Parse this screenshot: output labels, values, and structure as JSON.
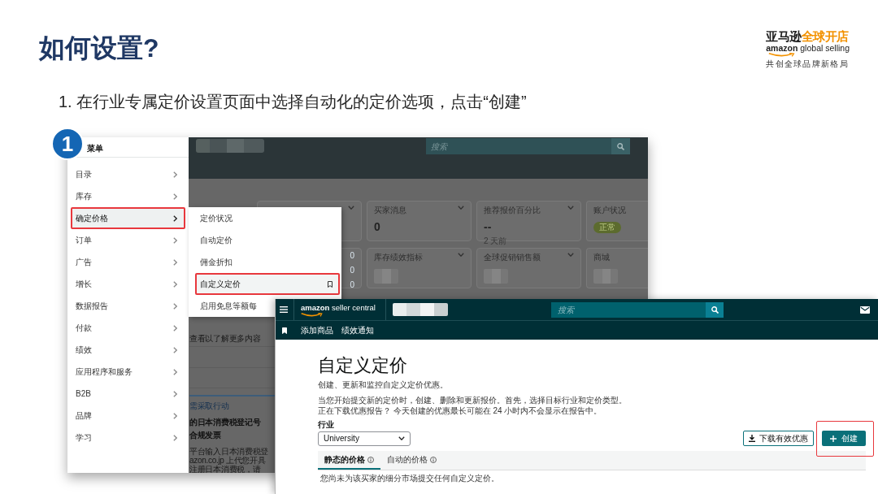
{
  "title": "如何设置?",
  "logo": {
    "wordmark": "亚马逊",
    "wordmark_accent": "全球开店",
    "brand_line": "**amazon** global selling",
    "slogan": "共创全球品牌新格局"
  },
  "instruction": "1. 在行业专属定价设置页面中选择自动化的定价选项，点击“创建”",
  "menu_screenshot": {
    "step_number": "1",
    "menu_title": "菜单",
    "menu_items": [
      {
        "label": "目录",
        "selected": false,
        "highlighted": false
      },
      {
        "label": "库存",
        "selected": false,
        "highlighted": false
      },
      {
        "label": "确定价格",
        "selected": true,
        "highlighted": true
      },
      {
        "label": "订单",
        "selected": false,
        "highlighted": false
      },
      {
        "label": "广告",
        "selected": false,
        "highlighted": false
      },
      {
        "label": "增长",
        "selected": false,
        "highlighted": false
      },
      {
        "label": "数据报告",
        "selected": false,
        "highlighted": false
      },
      {
        "label": "付款",
        "selected": false,
        "highlighted": false
      },
      {
        "label": "绩效",
        "selected": false,
        "highlighted": false
      },
      {
        "label": "应用程序和服务",
        "selected": false,
        "highlighted": false
      },
      {
        "label": "B2B",
        "selected": false,
        "highlighted": false
      },
      {
        "label": "品牌",
        "selected": false,
        "highlighted": false
      },
      {
        "label": "学习",
        "selected": false,
        "highlighted": false
      }
    ],
    "submenu_items": [
      {
        "label": "定价状况",
        "selected": false,
        "highlighted": false
      },
      {
        "label": "自动定价",
        "selected": false,
        "highlighted": false
      },
      {
        "label": "佣金折扣",
        "selected": false,
        "highlighted": false
      },
      {
        "label": "自定义定价",
        "selected": true,
        "highlighted": true
      },
      {
        "label": "启用免息等额每",
        "selected": false,
        "highlighted": false
      }
    ],
    "search_placeholder": "搜索",
    "card_rows": [
      [
        {
          "dropdown": true
        },
        {
          "title": "买家消息",
          "value": "0",
          "dropdown": true
        },
        {
          "title": "推荐报价百分比",
          "value": "--",
          "note": "2 天前",
          "dropdown": true
        },
        {
          "title": "账户状况",
          "status": "正常",
          "dropdown": false
        }
      ],
      [
        {
          "values": [
            "0",
            "0",
            "0"
          ],
          "dropdown": false
        },
        {
          "title": "库存绩效指标",
          "blurred": true,
          "dropdown": true
        },
        {
          "title": "全球促销销售额",
          "blurred": true,
          "dropdown": true
        },
        {
          "title": "商城",
          "blurred": true,
          "dropdown": false
        }
      ]
    ],
    "background_lines": [
      {
        "kind": "text",
        "text": "查看以了解更多内容"
      },
      {
        "kind": "link",
        "text": "需采取行动"
      },
      {
        "kind": "heading",
        "text": "的日本消费税登记号"
      },
      {
        "kind": "heading",
        "text": "合规发票"
      },
      {
        "kind": "text",
        "text": "平台输入日本消费税登"
      },
      {
        "kind": "text",
        "text": "azon.co.jp 上代您开具"
      },
      {
        "kind": "text",
        "text": "注册日本消费税，请"
      }
    ]
  },
  "pricing_screenshot": {
    "brand_line": "**amazon** seller central",
    "search_placeholder": "搜索",
    "nav_links": [
      "添加商品",
      "绩效通知"
    ],
    "heading": "自定义定价",
    "subtitle": "创建、更新和监控自定义定价优惠。",
    "description": [
      "当您开始提交新的定价时，创建、删除和更新报价。首先，选择目标行业和定价类型。",
      "正在下载优惠报告？ 今天创建的优惠最长可能在 24 小时内不会显示在报告中。"
    ],
    "industry_label": "行业",
    "industry_value": "University",
    "download_button": "下载有效优惠",
    "create_button": {
      "label": "创建",
      "highlighted": true
    },
    "tabs": [
      {
        "label": "静态的价格",
        "selected": true
      },
      {
        "label": "自动的价格",
        "selected": false
      }
    ],
    "empty_message": "您尚未为该买家的细分市场提交任何自定义定价。"
  }
}
